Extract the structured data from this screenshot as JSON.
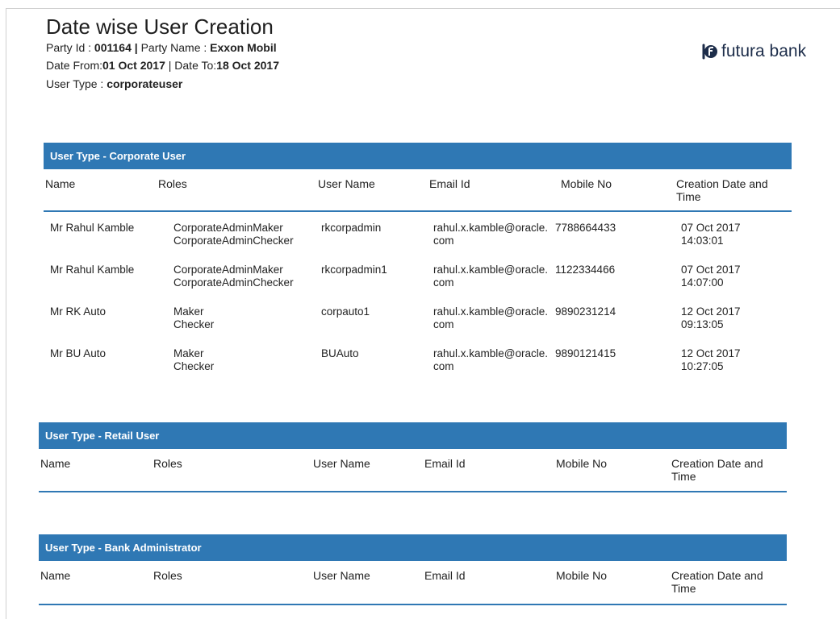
{
  "report": {
    "title": "Date wise User Creation",
    "party_id_label": "Party Id : ",
    "party_id": "001164",
    "party_sep": " | ",
    "party_name_label": "Party Name : ",
    "party_name": "Exxon Mobil",
    "date_from_label": "Date From:",
    "date_from": "01 Oct 2017",
    "date_sep": " | ",
    "date_to_label": "Date To:",
    "date_to": "18 Oct 2017",
    "user_type_label": "User Type : ",
    "user_type": "corporateuser"
  },
  "logo": {
    "text": "futura bank",
    "icon": "futura-bank-logo-icon",
    "color": "#1d2d4a"
  },
  "colors": {
    "header_bg": "#2f78b4",
    "header_text": "#ffffff"
  },
  "columns": {
    "name": "Name",
    "roles": "Roles",
    "user_name": "User Name",
    "email": "Email Id",
    "mobile": "Mobile No",
    "created_1": "Creation Date and",
    "created_2": "Time"
  },
  "sections": {
    "corporate": {
      "title": "User Type - Corporate User",
      "rows": [
        {
          "name": "Mr Rahul  Kamble",
          "role_1": "CorporateAdminMaker",
          "role_2": "CorporateAdminChecker",
          "user_name": "rkcorpadmin",
          "email_1": "rahul.x.kamble@oracle.",
          "email_2": "com",
          "mobile": "7788664433",
          "date": "07 Oct 2017",
          "time": "14:03:01"
        },
        {
          "name": "Mr Rahul  Kamble",
          "role_1": "CorporateAdminMaker",
          "role_2": "CorporateAdminChecker",
          "user_name": "rkcorpadmin1",
          "email_1": "rahul.x.kamble@oracle.",
          "email_2": "com",
          "mobile": "1122334466",
          "date": "07 Oct 2017",
          "time": "14:07:00"
        },
        {
          "name": "Mr RK  Auto",
          "role_1": "Maker",
          "role_2": "Checker",
          "user_name": "corpauto1",
          "email_1": "rahul.x.kamble@oracle.",
          "email_2": "com",
          "mobile": "9890231214",
          "date": "12 Oct 2017",
          "time": "09:13:05"
        },
        {
          "name": "Mr BU  Auto",
          "role_1": "Maker",
          "role_2": "Checker",
          "user_name": "BUAuto",
          "email_1": "rahul.x.kamble@oracle.",
          "email_2": "com",
          "mobile": "9890121415",
          "date": "12 Oct 2017",
          "time": "10:27:05"
        }
      ]
    },
    "retail": {
      "title": "User Type - Retail User"
    },
    "admin": {
      "title": "User Type - Bank Administrator"
    }
  }
}
